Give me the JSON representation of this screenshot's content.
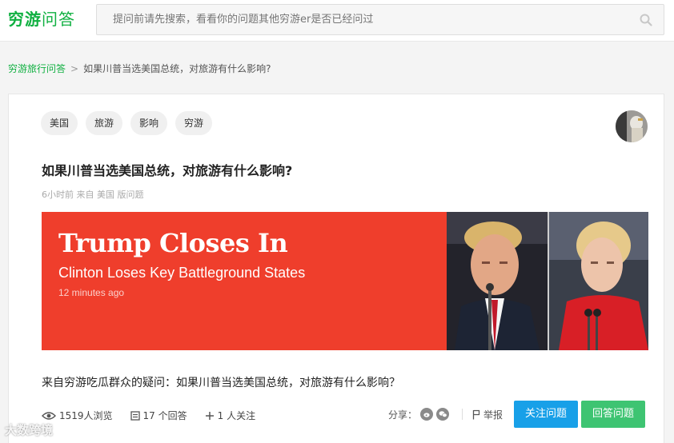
{
  "header": {
    "logo_brand": "穷游",
    "logo_sub": "问答",
    "search_placeholder": "提问前请先搜索，看看你的问题其他穷游er是否已经问过"
  },
  "breadcrumb": {
    "home": "穷游旅行问答",
    "separator": ">",
    "current": "如果川普当选美国总统，对旅游有什么影响?"
  },
  "question": {
    "tags": [
      "美国",
      "旅游",
      "影响",
      "穷游"
    ],
    "title": "如果川普当选美国总统，对旅游有什么影响?",
    "meta": "6小时前 来自 美国 版问题",
    "description": "来自穷游吃瓜群众的疑问：如果川普当选美国总统，对旅游有什么影响？"
  },
  "banner": {
    "headline": "Trump Closes In",
    "subhead": "Clinton Loses Key Battleground States",
    "time": "12 minutes ago"
  },
  "stats": {
    "views": "1519人浏览",
    "answers": "17 个回答",
    "followers": "1 人关注"
  },
  "actions": {
    "share_label": "分享：",
    "report_label": "举报",
    "follow_label": "关注问题",
    "answer_label": "回答问题"
  },
  "watermark": "大数跨境",
  "colors": {
    "brand_green": "#10b041",
    "follow_blue": "#18a0e8",
    "answer_green": "#3ec472",
    "banner_red": "#ef3e2c"
  },
  "icons": [
    "search-icon",
    "eye-icon",
    "answers-icon",
    "plus-icon",
    "weibo-icon",
    "wechat-icon",
    "flag-icon"
  ]
}
